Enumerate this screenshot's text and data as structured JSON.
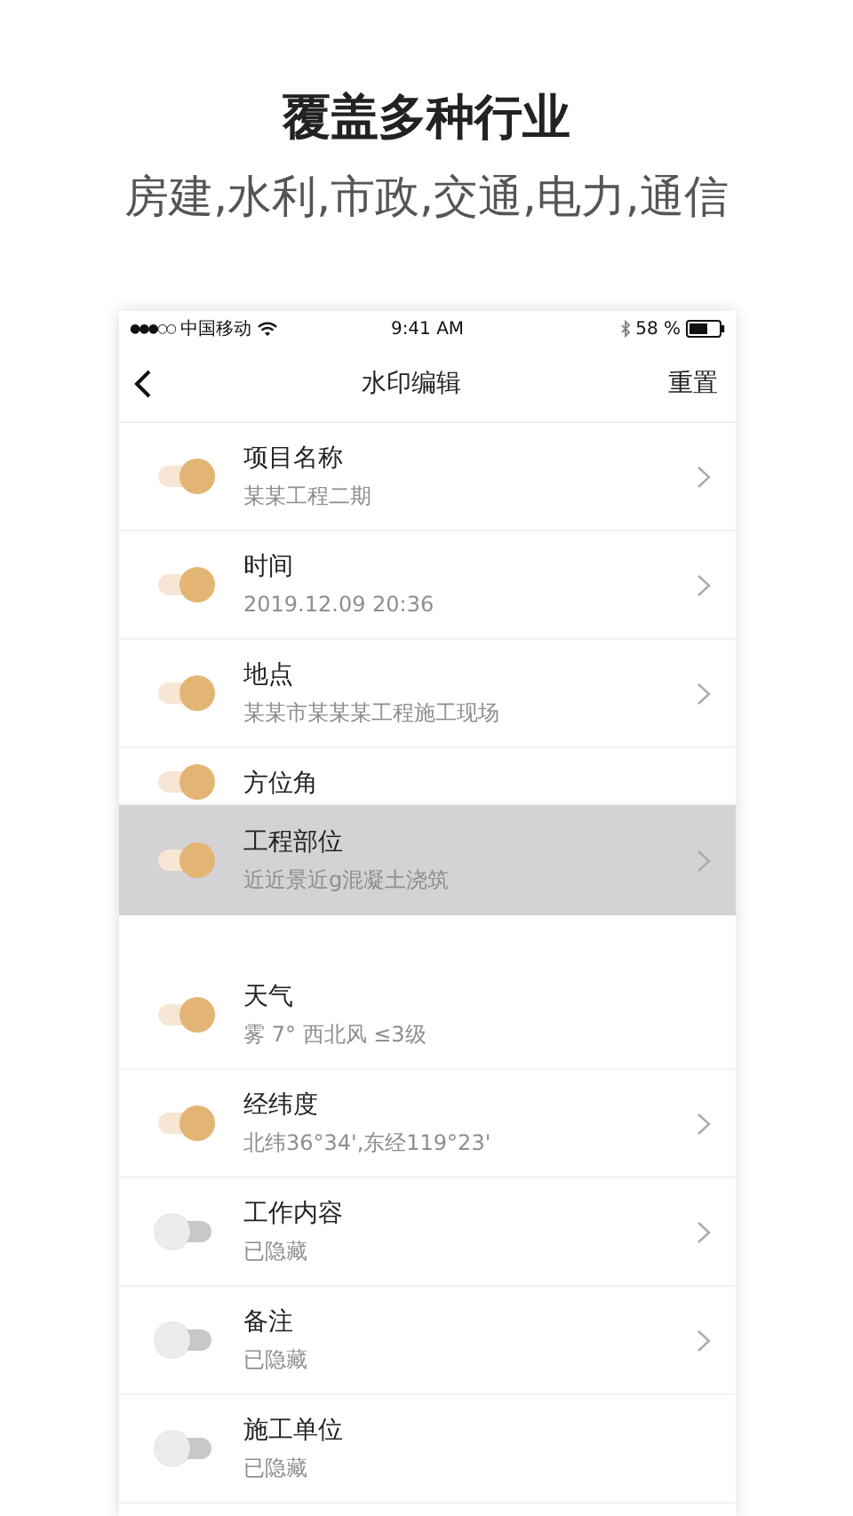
{
  "headline": {
    "title": "覆盖多种行业",
    "subtitle": "房建,水利,市政,交通,电力,通信"
  },
  "status_bar": {
    "signal": "●●●○○",
    "carrier": "中国移动",
    "time": "9:41 AM",
    "battery": "58 %"
  },
  "nav": {
    "title": "水印编辑",
    "action": "重置"
  },
  "fields": [
    {
      "title": "项目名称",
      "value": "某某工程二期",
      "on": true,
      "chevron": true,
      "dragging": false
    },
    {
      "title": "时间",
      "value": "2019.12.09 20:36",
      "on": true,
      "chevron": true,
      "dragging": false
    },
    {
      "title": "地点",
      "value": "某某市某某某工程施工现场",
      "on": true,
      "chevron": true,
      "dragging": false
    },
    {
      "title": "方位角",
      "on": true,
      "chevron": false,
      "dragging": false,
      "kind": "covered"
    },
    {
      "title": "工程部位",
      "value": "近近景近g混凝土浇筑",
      "on": true,
      "chevron": true,
      "dragging": true
    },
    {
      "title": "天气",
      "value": "雾 7° 西北风 ≤3级",
      "on": true,
      "chevron": false,
      "dragging": false
    },
    {
      "title": "经纬度",
      "value": "北纬36°34',东经119°23'",
      "on": true,
      "chevron": true,
      "dragging": false
    },
    {
      "title": "工作内容",
      "value": "已隐藏",
      "on": false,
      "chevron": true,
      "dragging": false
    },
    {
      "title": "备注",
      "value": "已隐藏",
      "on": false,
      "chevron": true,
      "dragging": false
    },
    {
      "title": "施工单位",
      "value": "已隐藏",
      "on": false,
      "chevron": false,
      "dragging": false
    }
  ]
}
